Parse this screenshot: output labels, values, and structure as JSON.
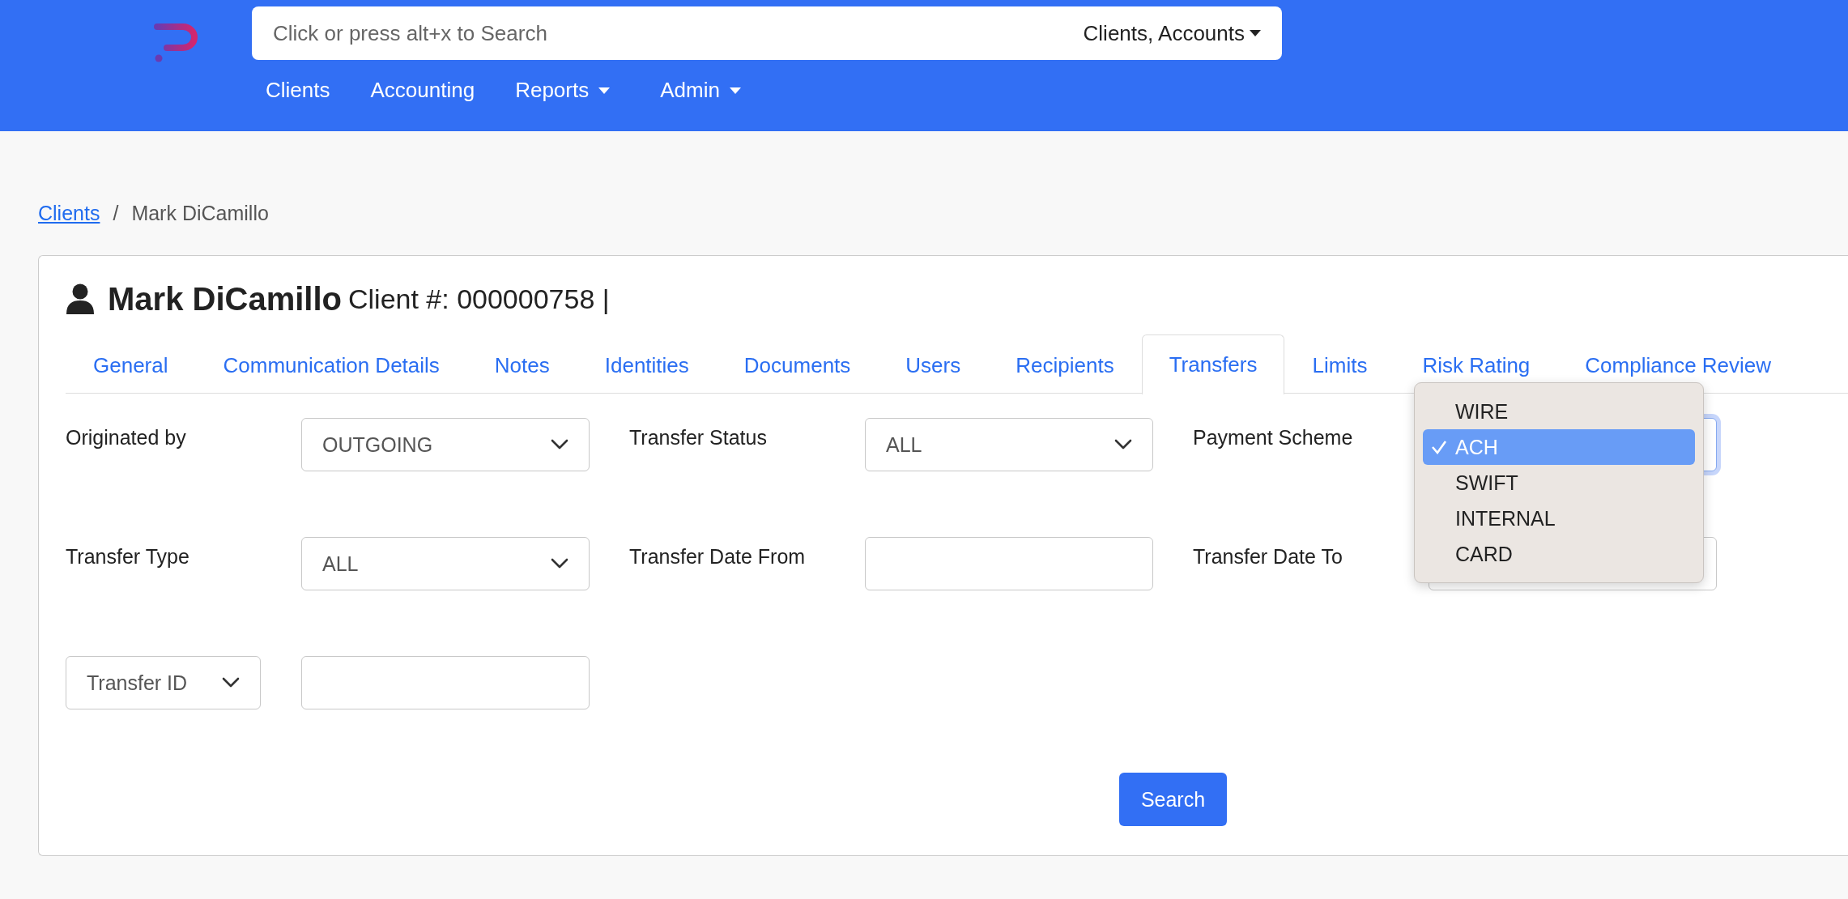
{
  "header": {
    "search": {
      "placeholder": "Click or press alt+x to Search",
      "scope": "Clients, Accounts"
    },
    "nav": [
      {
        "label": "Clients",
        "dropdown": false
      },
      {
        "label": "Accounting",
        "dropdown": false
      },
      {
        "label": "Reports",
        "dropdown": true
      },
      {
        "label": "Admin",
        "dropdown": true
      }
    ]
  },
  "breadcrumb": {
    "separator": "/",
    "items": [
      {
        "label": "Clients",
        "link": true
      },
      {
        "label": "Mark DiCamillo",
        "link": false
      }
    ]
  },
  "client": {
    "name": "Mark DiCamillo",
    "number": "Client #: 000000758 |"
  },
  "tabs": [
    {
      "label": "General",
      "selected": false
    },
    {
      "label": "Communication Details",
      "selected": false
    },
    {
      "label": "Notes",
      "selected": false
    },
    {
      "label": "Identities",
      "selected": false
    },
    {
      "label": "Documents",
      "selected": false
    },
    {
      "label": "Users",
      "selected": false
    },
    {
      "label": "Recipients",
      "selected": false
    },
    {
      "label": "Transfers",
      "selected": true
    },
    {
      "label": "Limits",
      "selected": false
    },
    {
      "label": "Risk Rating",
      "selected": false
    },
    {
      "label": "Compliance Review",
      "selected": false
    }
  ],
  "filters": [
    {
      "label": "Originated by",
      "kind": "select",
      "value": "OUTGOING",
      "focused": false
    },
    {
      "label": "Transfer Status",
      "kind": "select",
      "value": "ALL",
      "focused": false
    },
    {
      "label": "Payment Scheme",
      "kind": "select",
      "focused": true
    },
    {
      "label": "Transfer Type",
      "kind": "select",
      "value": "ALL",
      "focused": false
    },
    {
      "label": "Transfer Date From",
      "kind": "date",
      "focused": false
    },
    {
      "label": "Transfer Date To",
      "kind": "date",
      "focused": false
    }
  ],
  "id_filter": {
    "selector": "Transfer ID"
  },
  "search_button": "Search",
  "dropdown": {
    "options": [
      {
        "label": "WIRE",
        "selected": false
      },
      {
        "label": "ACH",
        "selected": true
      },
      {
        "label": "SWIFT",
        "selected": false
      },
      {
        "label": "INTERNAL",
        "selected": false
      },
      {
        "label": "CARD",
        "selected": false
      }
    ]
  }
}
